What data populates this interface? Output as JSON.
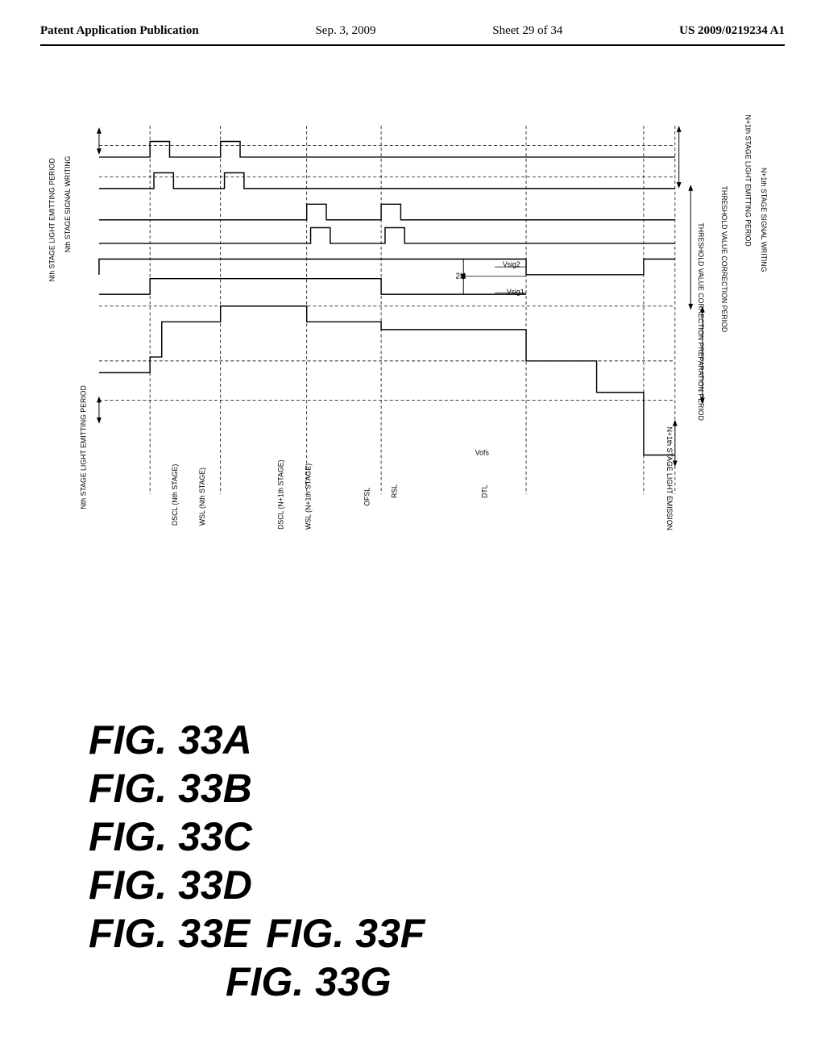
{
  "header": {
    "left": "Patent Application Publication",
    "center": "Sep. 3, 2009",
    "sheet": "Sheet 29 of 34",
    "right": "US 2009/0219234 A1"
  },
  "figures": [
    {
      "id": "fig-33a",
      "label": "FIG. 33A"
    },
    {
      "id": "fig-33b",
      "label": "FIG. 33B"
    },
    {
      "id": "fig-33c",
      "label": "FIG. 33C"
    },
    {
      "id": "fig-33d",
      "label": "FIG. 33D"
    },
    {
      "id": "fig-33e",
      "label": "FIG. 33E"
    },
    {
      "id": "fig-33f",
      "label": "FIG. 33F"
    },
    {
      "id": "fig-33g",
      "label": "FIG. 33G"
    }
  ]
}
